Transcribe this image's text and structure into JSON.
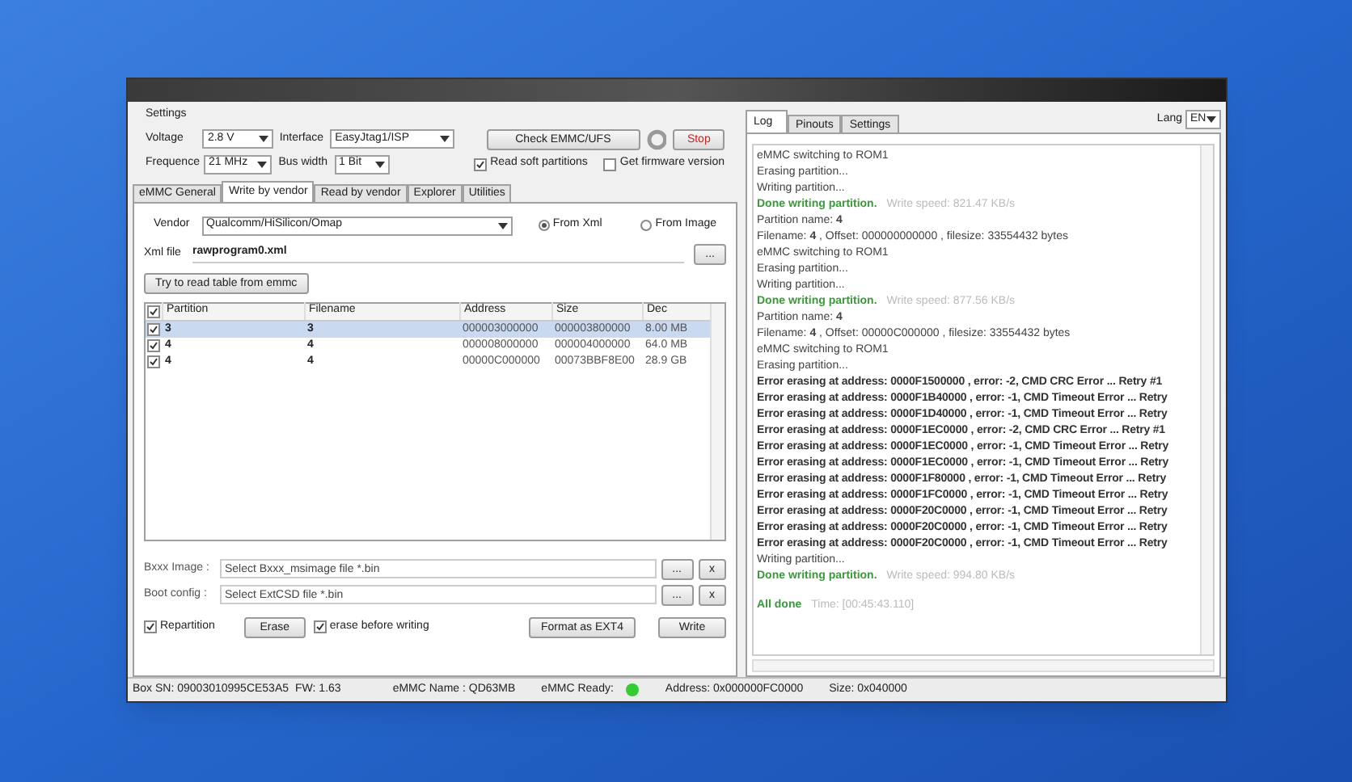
{
  "settings": {
    "title": "Settings",
    "voltage_label": "Voltage",
    "voltage": "2.8 V",
    "interface_label": "Interface",
    "interface": "EasyJtag1/ISP",
    "frequence_label": "Frequence",
    "frequence": "21 MHz",
    "bus_width_label": "Bus width",
    "bus_width": "1 Bit",
    "check_button": "Check EMMC/UFS",
    "stop_button": "Stop",
    "options": [
      {
        "label": "Read soft partitions",
        "checked": true
      },
      {
        "label": "Get firmware version",
        "checked": false
      }
    ]
  },
  "tabs": [
    {
      "label": "eMMC General",
      "selected": false
    },
    {
      "label": "Write by vendor",
      "selected": true
    },
    {
      "label": "Read by vendor",
      "selected": false
    },
    {
      "label": "Explorer",
      "selected": false
    },
    {
      "label": "Utilities",
      "selected": false
    }
  ],
  "vendor": {
    "label": "Vendor",
    "value": "Qualcomm/HiSilicon/Omap"
  },
  "sources": [
    {
      "label": "From Xml",
      "selected": true
    },
    {
      "label": "From Image",
      "selected": false
    }
  ],
  "xml_file": {
    "label": "Xml file",
    "value": "rawprogram0.xml",
    "browse": "..."
  },
  "read_table_button": "Try to read table from emmc",
  "table": {
    "header_checked": true,
    "columns": [
      "Partition",
      "Filename",
      "Address",
      "Size",
      "Dec"
    ],
    "rows": [
      {
        "checked": true,
        "selected": true,
        "cells": [
          "3",
          "3",
          "000003000000",
          "000003800000",
          "8.00 MB"
        ]
      },
      {
        "checked": true,
        "selected": false,
        "cells": [
          "4",
          "4",
          "000008000000",
          "000004000000",
          "64.0 MB"
        ]
      },
      {
        "checked": true,
        "selected": false,
        "cells": [
          "4",
          "4",
          "00000C000000",
          "00073BBF8E00",
          "28.9 GB"
        ]
      }
    ]
  },
  "image_fields": [
    {
      "label": "Bxxx Image :",
      "placeholder": "Select Bxxx_msimage file *.bin",
      "browse": "...",
      "clear": "x"
    },
    {
      "label": "Boot config :",
      "placeholder": "Select ExtCSD file *.bin",
      "browse": "...",
      "clear": "x"
    }
  ],
  "repartition": {
    "label": "Repartition",
    "checked": true
  },
  "erase_button": "Erase",
  "erase_before_writing": {
    "label": "erase before writing",
    "checked": true
  },
  "format_button": "Format as EXT4",
  "write_button": "Write",
  "right_tabs": [
    {
      "label": "Log",
      "selected": true
    },
    {
      "label": "Pinouts",
      "selected": false
    },
    {
      "label": "Settings",
      "selected": false
    }
  ],
  "lang": {
    "label": "Lang",
    "value": "EN"
  },
  "log": [
    {
      "kind": "plain",
      "text": "eMMC switching to ROM1"
    },
    {
      "kind": "plain",
      "text": "Erasing partition..."
    },
    {
      "kind": "plain",
      "text": "Writing partition..."
    },
    {
      "kind": "done",
      "text": "Done writing partition.",
      "note": "Write speed: 821.47 KB/s"
    },
    {
      "kind": "field",
      "text": "Partition name: **4**"
    },
    {
      "kind": "field",
      "text": "Filename: **4** , Offset: 000000000000 , filesize: 33554432 bytes"
    },
    {
      "kind": "plain",
      "text": "eMMC switching to ROM1"
    },
    {
      "kind": "plain",
      "text": "Erasing partition..."
    },
    {
      "kind": "plain",
      "text": "Writing partition..."
    },
    {
      "kind": "done",
      "text": "Done writing partition.",
      "note": "Write speed: 877.56 KB/s"
    },
    {
      "kind": "field",
      "text": "Partition name: **4**"
    },
    {
      "kind": "field",
      "text": "Filename: **4** , Offset: 00000C000000 , filesize: 33554432 bytes"
    },
    {
      "kind": "plain",
      "text": "eMMC switching to ROM1"
    },
    {
      "kind": "plain",
      "text": "Erasing partition..."
    },
    {
      "kind": "error",
      "text": "Error erasing at address: 0000F1500000 , error: -2, CMD CRC Error ... Retry #1"
    },
    {
      "kind": "error",
      "text": "Error erasing at address: 0000F1B40000 , error: -1, CMD Timeout Error ... Retry"
    },
    {
      "kind": "error",
      "text": "Error erasing at address: 0000F1D40000 , error: -1, CMD Timeout Error ... Retry"
    },
    {
      "kind": "error",
      "text": "Error erasing at address: 0000F1EC0000 , error: -2, CMD CRC Error ... Retry #1"
    },
    {
      "kind": "error",
      "text": "Error erasing at address: 0000F1EC0000 , error: -1, CMD Timeout Error ... Retry"
    },
    {
      "kind": "error",
      "text": "Error erasing at address: 0000F1EC0000 , error: -1, CMD Timeout Error ... Retry"
    },
    {
      "kind": "error",
      "text": "Error erasing at address: 0000F1F80000 , error: -1, CMD Timeout Error ... Retry"
    },
    {
      "kind": "error",
      "text": "Error erasing at address: 0000F1FC0000 , error: -1, CMD Timeout Error ... Retry"
    },
    {
      "kind": "error",
      "text": "Error erasing at address: 0000F20C0000 , error: -1, CMD Timeout Error ... Retry"
    },
    {
      "kind": "error",
      "text": "Error erasing at address: 0000F20C0000 , error: -1, CMD Timeout Error ... Retry"
    },
    {
      "kind": "error",
      "text": "Error erasing at address: 0000F20C0000 , error: -1, CMD Timeout Error ... Retry"
    },
    {
      "kind": "plain",
      "text": "Writing partition..."
    },
    {
      "kind": "done",
      "text": "Done writing partition.",
      "note": "Write speed: 994.80 KB/s"
    },
    {
      "kind": "gap"
    },
    {
      "kind": "done",
      "text": "All done",
      "note": "Time: [00:45:43.110]"
    }
  ],
  "status_bar": {
    "box_sn": "Box SN:  09003010995CE53A5",
    "fw": "FW:  1.63",
    "emmc_name": "eMMC Name : QD63MB",
    "ready_label": "eMMC Ready:",
    "ready": true,
    "address": "Address:  0x000000FC0000",
    "size": "Size:  0x040000"
  }
}
